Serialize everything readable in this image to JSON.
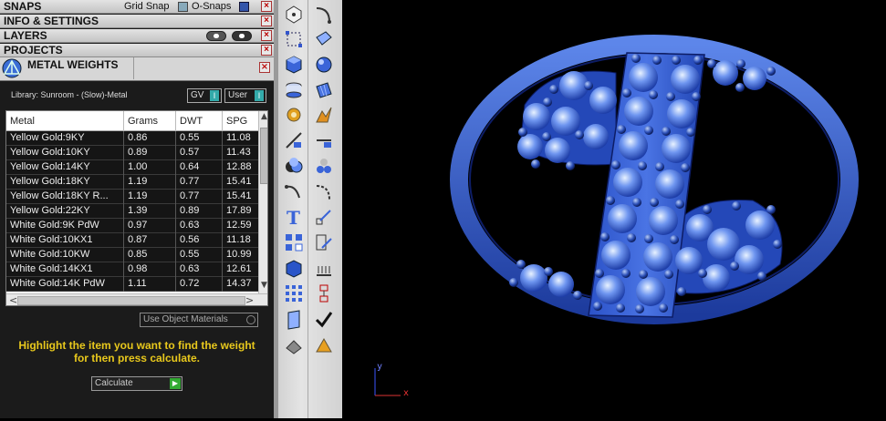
{
  "panels": {
    "snaps": "SNAPS",
    "grid_snap": "Grid Snap",
    "o_snaps": "O-Snaps",
    "info_settings": "INFO & SETTINGS",
    "layers": "LAYERS",
    "projects": "PROJECTS",
    "metal_weights": "METAL WEIGHTS",
    "close_glyph": "×"
  },
  "metal_weights": {
    "library_label": "Library: Sunroom - (Slow)-Metal",
    "gv_label": "GV",
    "user_label": "User",
    "toggle_glyph": "I",
    "columns": [
      "Metal",
      "Grams",
      "DWT",
      "SPG"
    ],
    "rows": [
      [
        "Yellow Gold:9KY",
        "0.86",
        "0.55",
        "11.08"
      ],
      [
        "Yellow Gold:10KY",
        "0.89",
        "0.57",
        "11.43"
      ],
      [
        "Yellow Gold:14KY",
        "1.00",
        "0.64",
        "12.88"
      ],
      [
        "Yellow Gold:18KY",
        "1.19",
        "0.77",
        "15.41"
      ],
      [
        "Yellow Gold:18KY R...",
        "1.19",
        "0.77",
        "15.41"
      ],
      [
        "Yellow Gold:22KY",
        "1.39",
        "0.89",
        "17.89"
      ],
      [
        "White Gold:9K PdW",
        "0.97",
        "0.63",
        "12.59"
      ],
      [
        "White Gold:10KX1",
        "0.87",
        "0.56",
        "11.18"
      ],
      [
        "White Gold:10KW",
        "0.85",
        "0.55",
        "10.99"
      ],
      [
        "White Gold:14KX1",
        "0.98",
        "0.63",
        "12.61"
      ],
      [
        "White Gold:14K PdW",
        "1.11",
        "0.72",
        "14.37"
      ]
    ],
    "scroll_up": "▲",
    "scroll_down": "▼",
    "scroll_left": "<",
    "scroll_right": ">",
    "use_object_materials": "Use Object Materials",
    "hint_line1": "Highlight the item you want to find the weight",
    "hint_line2": "for then press calculate.",
    "calculate_label": "Calculate",
    "go_glyph": "▶"
  },
  "viewport": {
    "axis_y": "y",
    "axis_x": "x"
  },
  "colors": {
    "accent_yellow": "#e8c81c",
    "model_blue": "#2c56d8",
    "toggle_teal": "#3aa",
    "close_red": "#b00"
  }
}
